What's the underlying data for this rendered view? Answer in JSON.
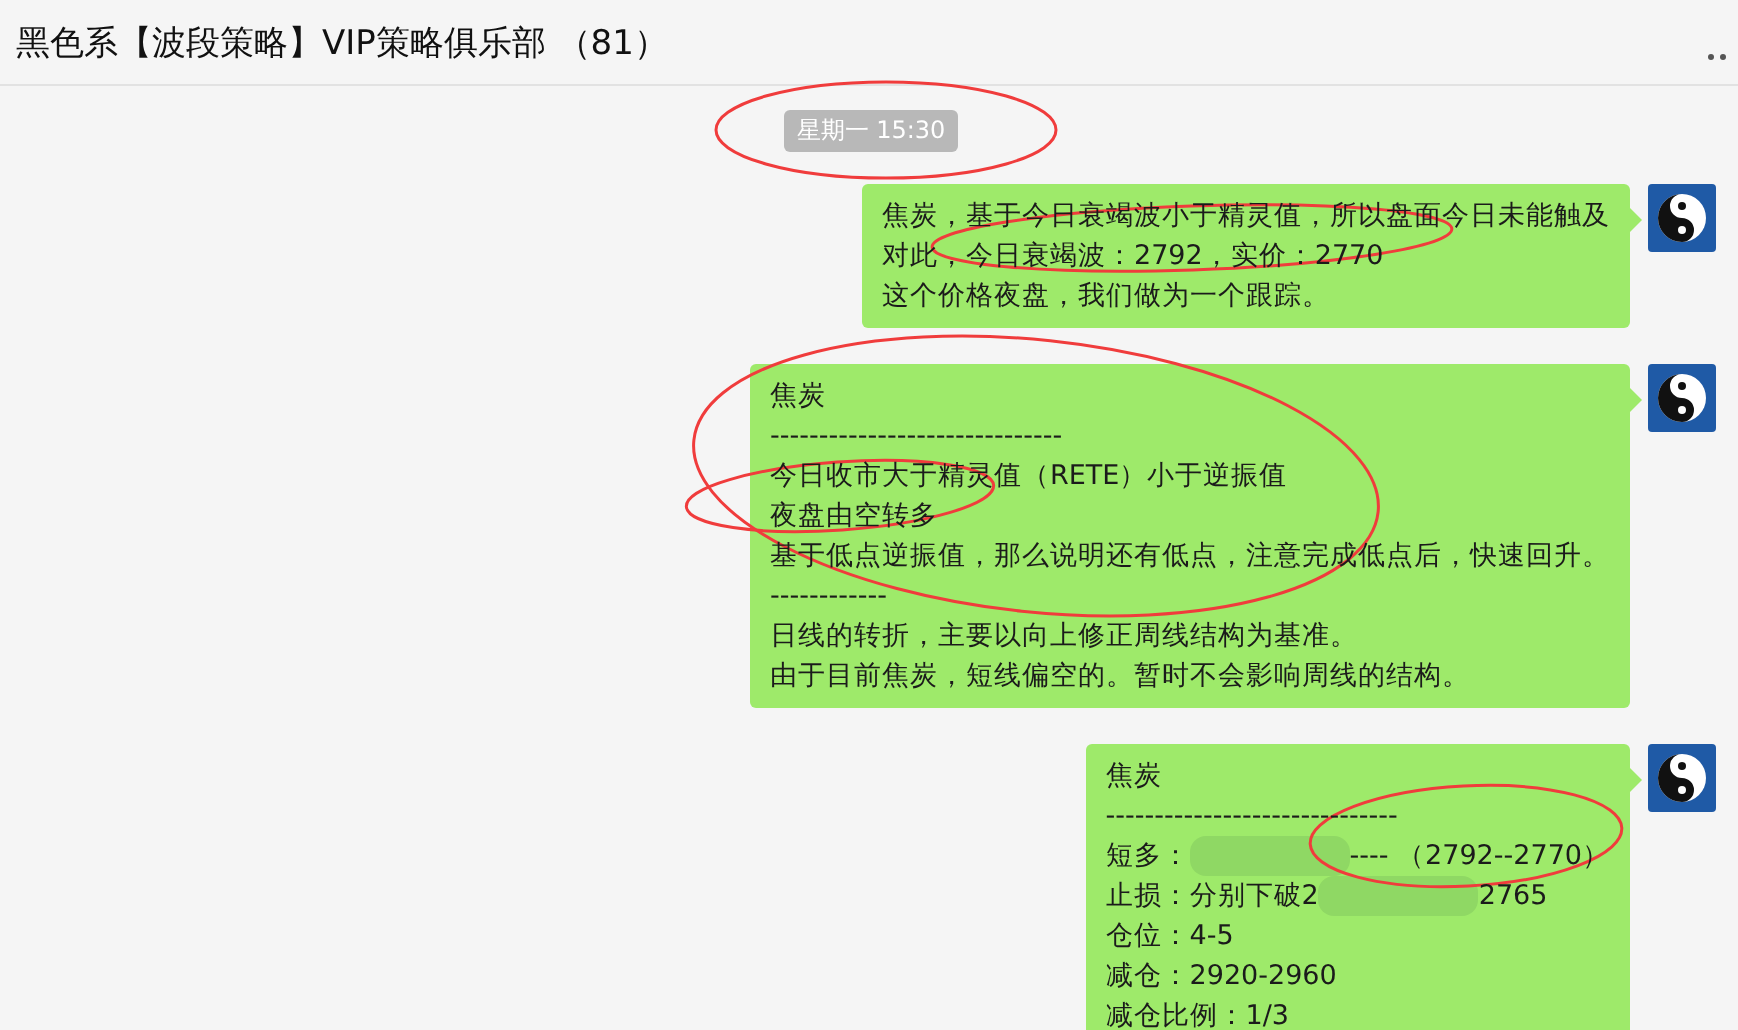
{
  "window": {
    "title": "黑色系【波段策略】VIP策略俱乐部 （81）"
  },
  "timestamp": "星期一 15:30",
  "messages": [
    {
      "lines": [
        {
          "kind": "text",
          "text": "焦炭，基于今日衰竭波小于精灵值，所以盘面今日未能触及"
        },
        {
          "kind": "text",
          "text": "对此，今日衰竭波：2792，实价：2770"
        },
        {
          "kind": "text",
          "text": "这个价格夜盘，我们做为一个跟踪。"
        }
      ]
    },
    {
      "lines": [
        {
          "kind": "text",
          "text": "焦炭"
        },
        {
          "kind": "text",
          "text": "------------------------------"
        },
        {
          "kind": "text",
          "text": "今日收市大于精灵值（RETE）小于逆振值"
        },
        {
          "kind": "text",
          "text": "夜盘由空转多"
        },
        {
          "kind": "text",
          "text": "基于低点逆振值，那么说明还有低点，注意完成低点后，快速回升。"
        },
        {
          "kind": "text",
          "text": "------------"
        },
        {
          "kind": "text",
          "text": "日线的转折，主要以向上修正周线结构为基准。"
        },
        {
          "kind": "text",
          "text": "由于目前焦炭，短线偏空的。暂时不会影响周线的结构。"
        }
      ]
    },
    {
      "lines": [
        {
          "kind": "text",
          "text": "焦炭"
        },
        {
          "kind": "text",
          "text": "------------------------------"
        },
        {
          "kind": "redacted",
          "before": "短多：",
          "after": "----  （2792--2770）"
        },
        {
          "kind": "redacted",
          "before": "止损：分别下破2",
          "after": "2765"
        },
        {
          "kind": "text",
          "text": "仓位：4-5"
        },
        {
          "kind": "text",
          "text": "减仓：2920-2960"
        },
        {
          "kind": "text",
          "text": "减仓比例：1/3"
        }
      ]
    }
  ]
}
